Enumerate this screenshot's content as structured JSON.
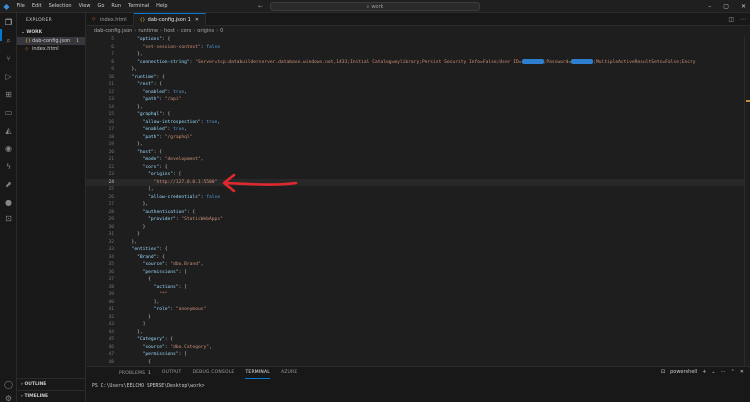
{
  "titlebar": {
    "menu": [
      "File",
      "Edit",
      "Selection",
      "View",
      "Go",
      "Run",
      "Terminal",
      "Help"
    ],
    "search": "work"
  },
  "sidebar": {
    "title": "EXPLORER",
    "section": "WORK",
    "files": [
      {
        "name": "dab-config.json",
        "badge": "1",
        "selected": true,
        "type": "json"
      },
      {
        "name": "index.html",
        "badge": "",
        "selected": false,
        "type": "html"
      }
    ],
    "outline": "OUTLINE",
    "timeline": "TIMELINE"
  },
  "tabs": [
    {
      "label": "index.html",
      "type": "html",
      "active": false
    },
    {
      "label": "dab-config.json 1",
      "type": "json",
      "active": true
    }
  ],
  "breadcrumb": [
    "dab-config.json",
    "runtime",
    "host",
    "cors",
    "origins",
    "0"
  ],
  "code_lines": [
    {
      "n": "5",
      "html": "    <span class=\"k\">\"options\"</span><span class=\"p\">: {</span>"
    },
    {
      "n": "6",
      "html": "      <span class=\"s\">\"set-session-context\"</span><span class=\"p\">: </span><span class=\"v\">false</span>"
    },
    {
      "n": "7",
      "html": "    <span class=\"p\">},</span>"
    },
    {
      "n": "8",
      "html": "    <span class=\"k\">\"connection-string\"</span><span class=\"p\">: </span><span class=\"s\">\"Server=tcp:databuilderserver.database.windows.net,1433;Initial Catalog=mylibrary;Persist Security Info=False;User ID=</span><span class=\"redact\"></span><span class=\"s\">;Password=</span><span class=\"redact\"></span><span class=\"s\">;MultipleActiveResultSets=False;Encry</span>"
    },
    {
      "n": "9",
      "html": "  <span class=\"p\">},</span>"
    },
    {
      "n": "10",
      "html": "  <span class=\"k\">\"runtime\"</span><span class=\"p\">: {</span>"
    },
    {
      "n": "11",
      "html": "    <span class=\"k\">\"rest\"</span><span class=\"p\">: {</span>"
    },
    {
      "n": "12",
      "html": "      <span class=\"k\">\"enabled\"</span><span class=\"p\">: </span><span class=\"v\">true</span><span class=\"p\">,</span>"
    },
    {
      "n": "13",
      "html": "      <span class=\"k\">\"path\"</span><span class=\"p\">: </span><span class=\"s\">\"/api\"</span>"
    },
    {
      "n": "14",
      "html": "    <span class=\"p\">},</span>"
    },
    {
      "n": "15",
      "html": "    <span class=\"k\">\"graphql\"</span><span class=\"p\">: {</span>"
    },
    {
      "n": "16",
      "html": "      <span class=\"k\">\"allow-introspection\"</span><span class=\"p\">: </span><span class=\"v\">true</span><span class=\"p\">,</span>"
    },
    {
      "n": "17",
      "html": "      <span class=\"k\">\"enabled\"</span><span class=\"p\">: </span><span class=\"v\">true</span><span class=\"p\">,</span>"
    },
    {
      "n": "18",
      "html": "      <span class=\"k\">\"path\"</span><span class=\"p\">: </span><span class=\"s\">\"/graphql\"</span>"
    },
    {
      "n": "19",
      "html": "    <span class=\"p\">},</span>"
    },
    {
      "n": "20",
      "html": "    <span class=\"k\">\"host\"</span><span class=\"p\">: {</span>"
    },
    {
      "n": "21",
      "html": "      <span class=\"k\">\"mode\"</span><span class=\"p\">: </span><span class=\"s\">\"development\"</span><span class=\"p\">,</span>"
    },
    {
      "n": "22",
      "html": "      <span class=\"k\">\"cors\"</span><span class=\"p\">: {</span>"
    },
    {
      "n": "23",
      "html": "        <span class=\"k\">\"origins\"</span><span class=\"p\">: [</span>"
    },
    {
      "n": "24",
      "html": "          <span class=\"s\">\"http://127.0.0.1:5500\"</span>",
      "current": true
    },
    {
      "n": "25",
      "html": "        <span class=\"p\">],</span>"
    },
    {
      "n": "26",
      "html": "        <span class=\"k\">\"allow-credentials\"</span><span class=\"p\">: </span><span class=\"v\">false</span>"
    },
    {
      "n": "27",
      "html": "      <span class=\"p\">},</span>"
    },
    {
      "n": "28",
      "html": "      <span class=\"k\">\"authentication\"</span><span class=\"p\">: {</span>"
    },
    {
      "n": "29",
      "html": "        <span class=\"k\">\"provider\"</span><span class=\"p\">: </span><span class=\"s\">\"StaticWebApps\"</span>"
    },
    {
      "n": "30",
      "html": "      <span class=\"p\">}</span>"
    },
    {
      "n": "31",
      "html": "    <span class=\"p\">}</span>"
    },
    {
      "n": "32",
      "html": "  <span class=\"p\">},</span>"
    },
    {
      "n": "33",
      "html": "  <span class=\"k\">\"entities\"</span><span class=\"p\">: {</span>"
    },
    {
      "n": "34",
      "html": "    <span class=\"k\">\"Brand\"</span><span class=\"p\">: {</span>"
    },
    {
      "n": "35",
      "html": "      <span class=\"k\">\"source\"</span><span class=\"p\">: </span><span class=\"s\">\"dbo.Brand\"</span><span class=\"p\">,</span>"
    },
    {
      "n": "36",
      "html": "      <span class=\"k\">\"permissions\"</span><span class=\"p\">: [</span>"
    },
    {
      "n": "37",
      "html": "        <span class=\"p\">{</span>"
    },
    {
      "n": "38",
      "html": "          <span class=\"k\">\"actions\"</span><span class=\"p\">: [</span>"
    },
    {
      "n": "39",
      "html": "            <span class=\"s\">\"*\"</span>"
    },
    {
      "n": "40",
      "html": "          <span class=\"p\">],</span>"
    },
    {
      "n": "41",
      "html": "          <span class=\"k\">\"role\"</span><span class=\"p\">: </span><span class=\"s\">\"anonymous\"</span>"
    },
    {
      "n": "42",
      "html": "        <span class=\"p\">}</span>"
    },
    {
      "n": "43",
      "html": "      <span class=\"p\">]</span>"
    },
    {
      "n": "44",
      "html": "    <span class=\"p\">},</span>"
    },
    {
      "n": "45",
      "html": "    <span class=\"k\">\"Category\"</span><span class=\"p\">: {</span>"
    },
    {
      "n": "46",
      "html": "      <span class=\"k\">\"source\"</span><span class=\"p\">: </span><span class=\"s\">\"dbo.Category\"</span><span class=\"p\">,</span>"
    },
    {
      "n": "47",
      "html": "      <span class=\"k\">\"permissions\"</span><span class=\"p\">: [</span>"
    },
    {
      "n": "48",
      "html": "        <span class=\"p\">{</span>"
    }
  ],
  "panel": {
    "tabs": [
      {
        "label": "PROBLEMS",
        "badge": "1",
        "active": false
      },
      {
        "label": "OUTPUT",
        "badge": "",
        "active": false
      },
      {
        "label": "DEBUG CONSOLE",
        "badge": "",
        "active": false
      },
      {
        "label": "TERMINAL",
        "badge": "",
        "active": true
      },
      {
        "label": "AZURE",
        "badge": "",
        "active": false
      }
    ],
    "shell": "powershell",
    "prompt": "PS C:\\Users\\EELCHO SPERSE\\Desktop\\work>"
  },
  "colors": {
    "accent": "#0078d4",
    "annotation": "#e0282f"
  }
}
